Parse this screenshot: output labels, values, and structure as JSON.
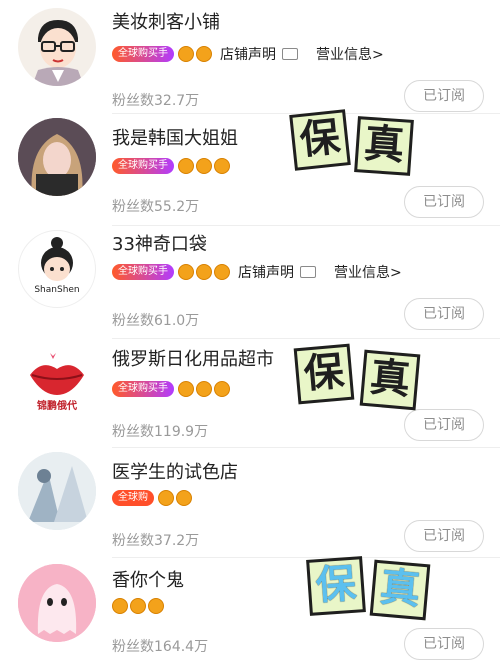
{
  "shops": [
    {
      "name": "美妆刺客小铺",
      "badge": "全球购买手",
      "crowns": 2,
      "extra1": "店铺声明",
      "extra2": "营业信息>",
      "fans": "粉丝数32.7万",
      "button": "已订阅",
      "avatar": "cartoon-man-glasses"
    },
    {
      "name": "我是韩国大姐姐",
      "badge": "全球购买手",
      "crowns": 3,
      "fans": "粉丝数55.2万",
      "button": "已订阅",
      "avatar": "woman-photo"
    },
    {
      "name": "33神奇口袋",
      "badge": "全球购买手",
      "crowns": 3,
      "extra1": "店铺声明",
      "extra2": "营业信息>",
      "fans": "粉丝数61.0万",
      "button": "已订阅",
      "avatar": "cartoon-girl-bun",
      "avatar_caption": "ShanShen"
    },
    {
      "name": "俄罗斯日化用品超市",
      "badge": "全球购买手",
      "crowns": 3,
      "fans": "粉丝数119.9万",
      "button": "已订阅",
      "avatar": "red-lips-logo",
      "avatar_caption": "锦鹏俄代"
    },
    {
      "name": "医学生的试色店",
      "badge": "全球购",
      "crowns": 2,
      "fans": "粉丝数37.2万",
      "button": "已订阅",
      "avatar": "illustration"
    },
    {
      "name": "香你个鬼",
      "badge": "",
      "crowns": 3,
      "fans": "粉丝数164.4万",
      "button": "已订阅",
      "avatar": "pink-ghost"
    }
  ],
  "stamps": {
    "char1": "保",
    "char2": "真"
  },
  "colors": {
    "badge_start": "#ff5a2a",
    "badge_end": "#b13cff",
    "crown": "#f3a21b",
    "stamp_bg": "#e9f6c8",
    "stamp_blue": "#5cc0ef"
  }
}
